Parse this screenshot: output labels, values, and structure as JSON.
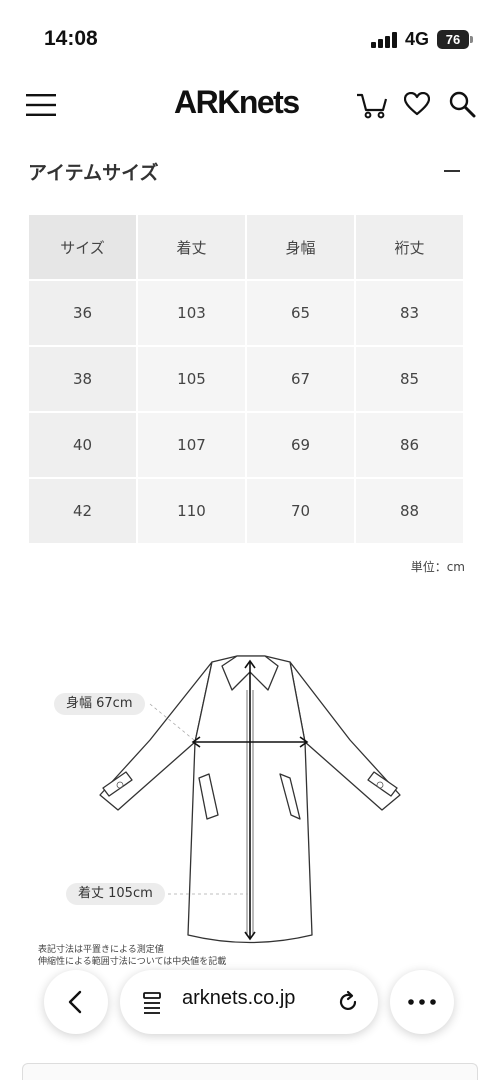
{
  "status_bar": {
    "time": "14:08",
    "network": "4G",
    "battery": "76"
  },
  "header": {
    "logo": "ARKnets",
    "menu_icon": "hamburger-icon",
    "cart_icon": "cart-icon",
    "favorite_icon": "heart-icon",
    "search_icon": "search-icon"
  },
  "section": {
    "title": "アイテムサイズ",
    "toggle_symbol": "−"
  },
  "size_table": {
    "headers": [
      "サイズ",
      "着丈",
      "身幅",
      "裄丈"
    ],
    "rows": [
      [
        "36",
        "103",
        "65",
        "83"
      ],
      [
        "38",
        "105",
        "67",
        "85"
      ],
      [
        "40",
        "107",
        "69",
        "86"
      ],
      [
        "42",
        "110",
        "70",
        "88"
      ]
    ],
    "unit": "単位：cm"
  },
  "illustration": {
    "width_label": "身幅 67cm",
    "length_label": "着丈 105cm",
    "notes": [
      "表記寸法は平置きによる測定値",
      "伸縮性による範囲寸法については中央値を記載"
    ]
  },
  "browser": {
    "url": "arknets.co.jp",
    "back_icon": "chevron-left-icon",
    "tabs_icon": "page-icon",
    "reload_icon": "reload-icon",
    "more_icon": "ellipsis-icon"
  }
}
